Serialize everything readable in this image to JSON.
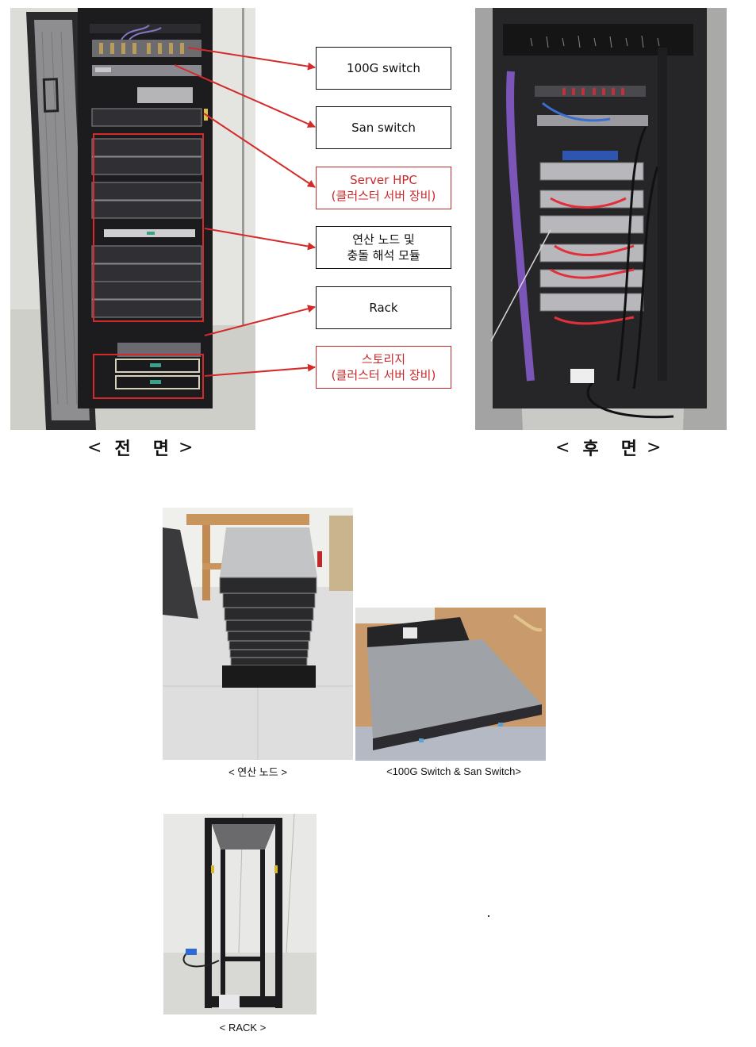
{
  "front_photo": {
    "caption_open": "<",
    "caption_word1": "전",
    "caption_word2": "면",
    "caption_close": ">",
    "alt": "Front view of server rack with open door"
  },
  "rear_photo": {
    "caption_open": "<",
    "caption_word1": "후",
    "caption_word2": "면",
    "caption_close": ">",
    "alt": "Rear view of server rack with cabling"
  },
  "callouts": [
    {
      "lines": [
        "100G switch"
      ],
      "style": "black"
    },
    {
      "lines": [
        "San switch"
      ],
      "style": "black"
    },
    {
      "lines": [
        "Server HPC",
        "(클러스터 서버 장비)"
      ],
      "style": "red"
    },
    {
      "lines": [
        "연산 노드 및",
        "충돌 해석 모듈"
      ],
      "style": "black"
    },
    {
      "lines": [
        "Rack"
      ],
      "style": "black"
    },
    {
      "lines": [
        "스토리지",
        "(클러스터 서버 장비)"
      ],
      "style": "red"
    }
  ],
  "colors": {
    "accent_red": "#c8282a",
    "box_border": "#111111"
  },
  "lower_photos": [
    {
      "caption": "< 연산 노드 >",
      "alt": "Stack of compute node servers on a pallet"
    },
    {
      "caption": "<100G Switch & San Switch>",
      "alt": "Network switches on a desk"
    },
    {
      "caption": "< RACK >",
      "alt": "Empty open-frame rack"
    }
  ],
  "stray_mark": "."
}
